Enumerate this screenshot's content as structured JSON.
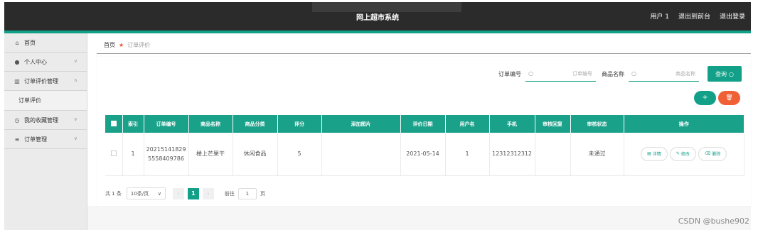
{
  "header": {
    "title": "网上超市系统",
    "links": [
      "用户 1",
      "退出到前台",
      "退出登录"
    ]
  },
  "sidebar": {
    "items": [
      {
        "icon": "home-icon",
        "glyph": "⌂",
        "label": "首页",
        "chevron": ""
      },
      {
        "icon": "user-icon",
        "glyph": "●",
        "label": "个人中心",
        "chevron": "∨"
      },
      {
        "icon": "chart-icon",
        "glyph": "▥",
        "label": "订单评价管理",
        "chevron": "∧"
      },
      {
        "icon": "clock-icon",
        "glyph": "◷",
        "label": "我的收藏管理",
        "chevron": "∨"
      },
      {
        "icon": "list-icon",
        "glyph": "≡",
        "label": "订单管理",
        "chevron": "∨"
      }
    ],
    "sub_item": "订单评价"
  },
  "breadcrumb": {
    "home": "首页",
    "current": "订单评价"
  },
  "search": {
    "order_label": "订单编号",
    "order_placeholder": "订单编号",
    "goods_label": "商品名称",
    "goods_placeholder": "商品名称",
    "query_label": "查询",
    "add_glyph": "+",
    "delete_glyph": "🗑"
  },
  "table": {
    "headers": [
      "索引",
      "订单编号",
      "商品名称",
      "商品分类",
      "评分",
      "添加图片",
      "评价日期",
      "用户名",
      "手机",
      "审核回复",
      "审核状态",
      "操作"
    ],
    "rows": [
      {
        "index": "1",
        "order_no_1": "20215141829",
        "order_no_2": "5558409786",
        "goods": "楼上芒果干",
        "category": "休闲食品",
        "score": "5",
        "image": "",
        "date": "2021-05-14",
        "user": "1",
        "phone": "12312312312",
        "reply": "",
        "status": "未通过"
      }
    ],
    "actions": [
      "详情",
      "修改",
      "删除"
    ]
  },
  "pagination": {
    "total": "共 1 条",
    "page_size": "10条/页",
    "current": "1",
    "goto_label": "前往",
    "goto_value": "1",
    "page_suffix": "页"
  },
  "watermark": "CSDN @bushe902",
  "colors": {
    "accent": "#12a188",
    "danger": "#f06036",
    "topbar": "#2b2b2b"
  }
}
